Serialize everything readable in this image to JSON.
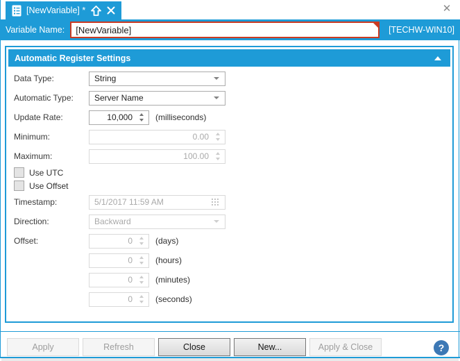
{
  "window": {
    "close_glyph": "✕"
  },
  "tab": {
    "title": "[NewVariable] *"
  },
  "header": {
    "variable_name_label": "Variable Name:",
    "variable_name_value": "[NewVariable]",
    "machine_name": "[TECHW-WIN10]"
  },
  "section": {
    "title": "Automatic Register Settings"
  },
  "form": {
    "data_type": {
      "label": "Data Type:",
      "value": "String"
    },
    "automatic_type": {
      "label": "Automatic Type:",
      "value": "Server Name"
    },
    "update_rate": {
      "label": "Update Rate:",
      "value": "10,000",
      "unit": "(milliseconds)"
    },
    "minimum": {
      "label": "Minimum:",
      "value": "0.00"
    },
    "maximum": {
      "label": "Maximum:",
      "value": "100.00"
    },
    "use_utc": {
      "label": "Use UTC",
      "checked": false
    },
    "use_offset": {
      "label": "Use Offset",
      "checked": false
    },
    "timestamp": {
      "label": "Timestamp:",
      "value": "5/1/2017 11:59 AM"
    },
    "direction": {
      "label": "Direction:",
      "value": "Backward"
    },
    "offset": {
      "label": "Offset:",
      "fields": [
        {
          "value": "0",
          "unit": "(days)"
        },
        {
          "value": "0",
          "unit": "(hours)"
        },
        {
          "value": "0",
          "unit": "(minutes)"
        },
        {
          "value": "0",
          "unit": "(seconds)"
        }
      ]
    }
  },
  "footer": {
    "buttons": [
      {
        "label": "Apply",
        "enabled": false
      },
      {
        "label": "Refresh",
        "enabled": false
      },
      {
        "label": "Close",
        "enabled": true
      },
      {
        "label": "New...",
        "enabled": true
      },
      {
        "label": "Apply & Close",
        "enabled": false
      }
    ],
    "help_label": "?"
  },
  "colors": {
    "accent_blue": "#1E9BD7",
    "error_border": "#CA3B23",
    "help_blue": "#3C78B5",
    "disabled_text": "#A9A9A9"
  }
}
